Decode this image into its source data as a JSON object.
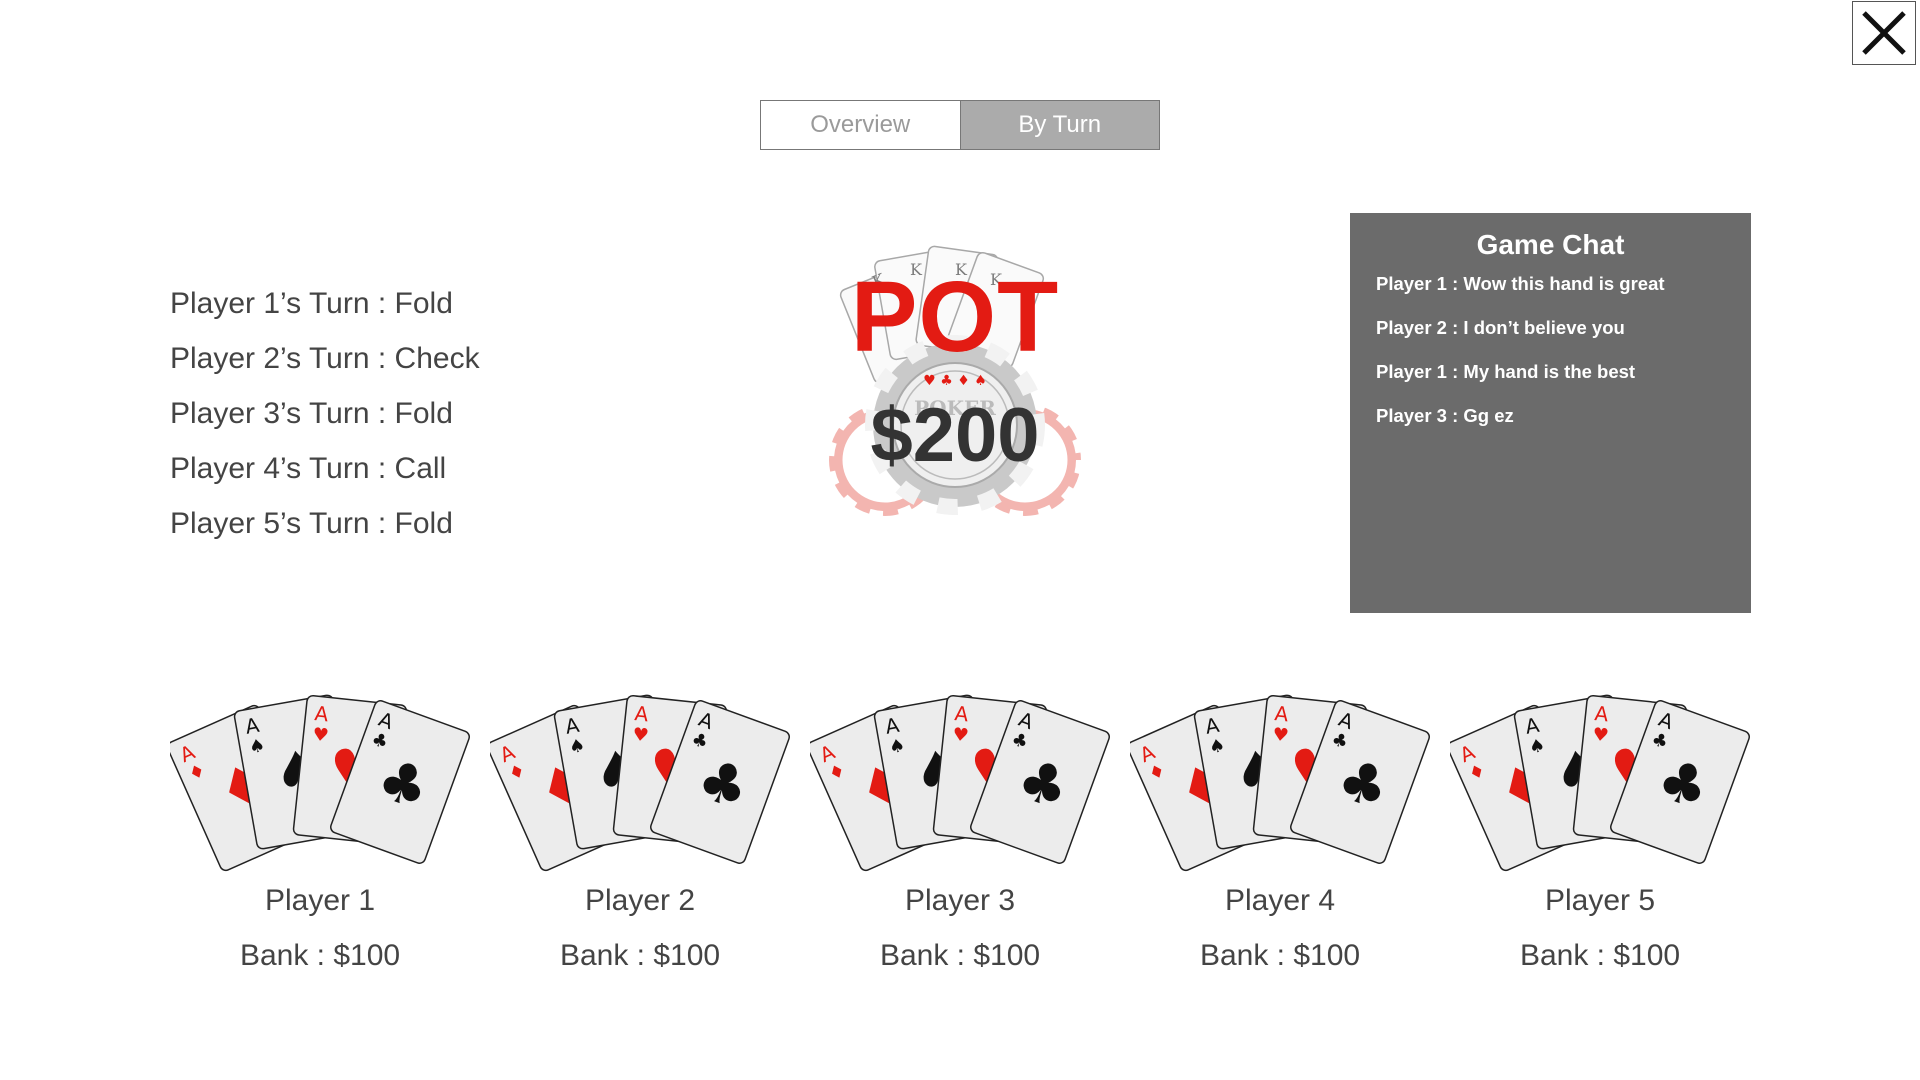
{
  "close": {
    "label": "close"
  },
  "tabs": [
    {
      "label": "Overview",
      "active": false
    },
    {
      "label": "By Turn",
      "active": true
    }
  ],
  "turns": [
    "Player 1’s Turn : Fold",
    "Player 2’s Turn : Check",
    "Player 3’s Turn : Fold",
    "Player 4’s Turn : Call",
    "Player 5’s Turn : Fold"
  ],
  "pot": {
    "label": "POT",
    "amount": "$200",
    "chip_text": "POKER"
  },
  "chat": {
    "title": "Game Chat",
    "messages": [
      "Player 1 : Wow this hand is great",
      "Player 2 : I don’t believe you",
      "Player 1 : My hand is the best",
      "Player 3 : Gg ez"
    ]
  },
  "players": [
    {
      "name": "Player 1",
      "bank": "Bank : $100"
    },
    {
      "name": "Player 2",
      "bank": "Bank : $100"
    },
    {
      "name": "Player 3",
      "bank": "Bank : $100"
    },
    {
      "name": "Player 4",
      "bank": "Bank : $100"
    },
    {
      "name": "Player 5",
      "bank": "Bank : $100"
    }
  ],
  "cards": [
    {
      "rank": "A",
      "suit": "♦",
      "color": "#e31b13"
    },
    {
      "rank": "A",
      "suit": "♠",
      "color": "#111111"
    },
    {
      "rank": "A",
      "suit": "♥",
      "color": "#e31b13"
    },
    {
      "rank": "A",
      "suit": "♣",
      "color": "#111111"
    }
  ],
  "colors": {
    "pot_red": "#e31b13",
    "chat_bg": "#6b6b6b",
    "tab_active_bg": "#ababab"
  }
}
